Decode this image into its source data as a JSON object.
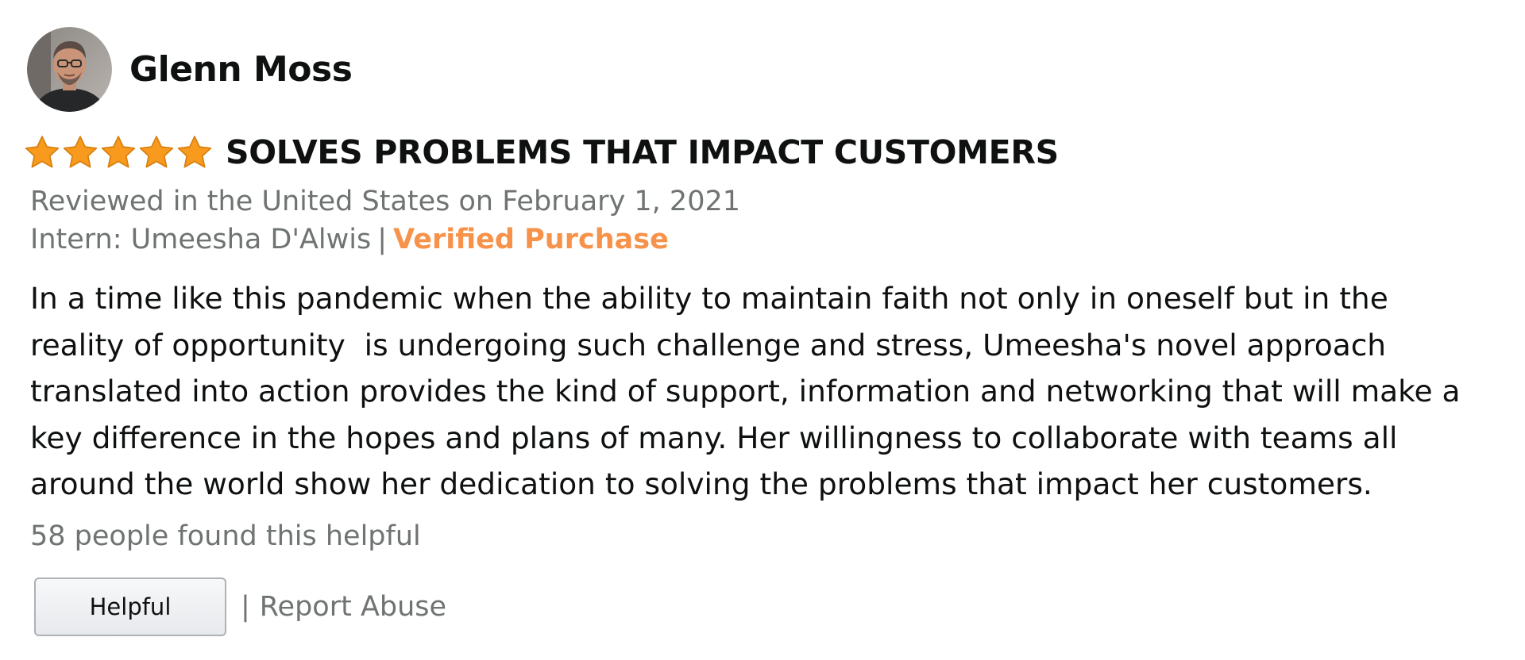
{
  "reviewer": {
    "name": "Glenn Moss",
    "avatar_icon": "person-avatar"
  },
  "rating": {
    "stars": 5,
    "max_stars": 5,
    "star_color": "#f79a1e",
    "star_icon": "star-icon"
  },
  "review": {
    "title": "SOLVES PROBLEMS THAT IMPACT CUSTOMERS",
    "date_line": "Reviewed in the United States on February 1, 2021",
    "format_label": "Intern: Umeesha D'Alwis",
    "separator": "|",
    "verified_label": "Verified Purchase",
    "verified_color": "#f7924a",
    "body_lines": [
      "In a time like this pandemic when the ability to maintain faith not only in oneself but in the",
      "reality of opportunity  is undergoing such challenge and stress, Umeesha's novel approach",
      "translated into action provides the kind of support, information and networking that will make a",
      "key difference in the hopes and plans of many. Her willingness to collaborate with teams all",
      "around the world show her dedication to solving the problems that impact her customers."
    ]
  },
  "footer": {
    "helpful_count_text": "58 people found this helpful",
    "helpful_button_label": "Helpful",
    "separator": "|",
    "report_label": "Report Abuse"
  }
}
